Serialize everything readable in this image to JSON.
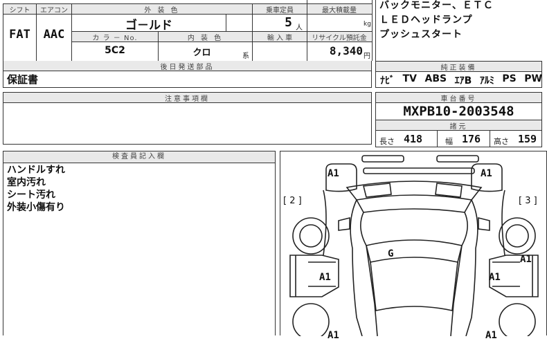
{
  "top_left": {
    "shift_label": "シフト",
    "aircon_label": "エアコン",
    "exterior_color_label": "外 装 色",
    "capacity_label": "乗車定員",
    "max_load_label": "最大積載量",
    "shift_value": "FAT",
    "aircon_value": "AAC",
    "exterior_color_value": "ゴ－ルド",
    "capacity_value": "5",
    "capacity_unit": "人",
    "max_load_unit": "kg",
    "color_no_label": "カ ラ － No.",
    "interior_color_label": "内 装 色",
    "import_label": "輸 入 車",
    "recycle_label": "リサイクル預託金",
    "color_no_value": "5C2",
    "interior_color_value": "クロ",
    "interior_suffix": "系",
    "recycle_value": "8,340",
    "recycle_unit": "円"
  },
  "later_items": {
    "header": "後日発送部品",
    "value": "保証書"
  },
  "remarks": {
    "header": "注意事項欄",
    "value": ""
  },
  "inspector": {
    "header": "検査員記入欄",
    "notes": [
      "ハンドルすれ",
      "室内汚れ",
      "シート汚れ",
      "外装小傷有り"
    ]
  },
  "features": {
    "lines": [
      "バックモニター、ＥＴＣ",
      "ＬＥＤヘッドランプ",
      "プッシュスタート"
    ]
  },
  "genuine_equipment": {
    "header": "純正装備",
    "items": [
      "ﾅﾋﾞ",
      "TV",
      "ABS",
      "ｴｱB",
      "ｱﾙﾐ",
      "PS",
      "PW"
    ]
  },
  "chassis": {
    "header": "車台番号",
    "value": "MXPB10-2003548"
  },
  "specs": {
    "header": "諸元",
    "length_label": "長さ",
    "length_value": "418",
    "width_label": "幅",
    "width_value": "176",
    "height_label": "高さ",
    "height_value": "159"
  },
  "diagram": {
    "marks": [
      "A1",
      "A1",
      "G",
      "A1",
      "A1",
      "A1",
      "A1",
      "A1"
    ],
    "left_tag": "[ 2 ]",
    "right_tag": "[ 3 ]"
  }
}
